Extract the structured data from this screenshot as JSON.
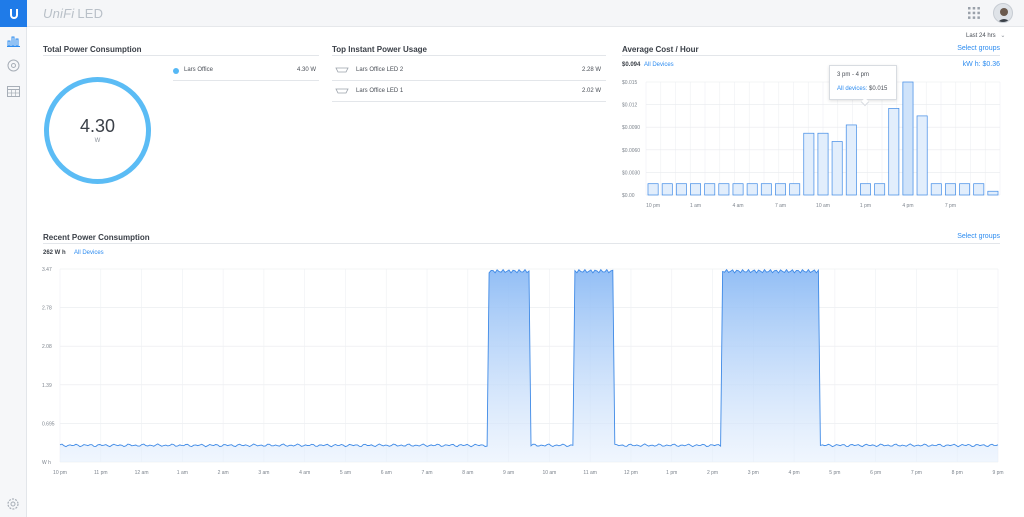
{
  "brand": {
    "name": "UniFi",
    "product": "LED"
  },
  "header": {
    "range_label": "Last 24 hrs"
  },
  "total_power": {
    "title": "Total Power Consumption",
    "value": "4.30",
    "unit": "W",
    "legend": [
      {
        "name": "Lars Office",
        "value": "4.30 W"
      }
    ]
  },
  "top_instant": {
    "title": "Top Instant Power Usage",
    "rows": [
      {
        "name": "Lars Office LED 2",
        "value": "2.28 W"
      },
      {
        "name": "Lars Office LED 1",
        "value": "2.02 W"
      }
    ]
  },
  "avg_cost": {
    "title": "Average Cost / Hour",
    "select_groups": "Select groups",
    "total": "$0.094",
    "filter": "All Devices",
    "rate": "kW h: $0.36",
    "tooltip": {
      "time": "3 pm - 4 pm",
      "label": "All devices:",
      "value": "$0.015"
    }
  },
  "recent_power": {
    "title": "Recent Power Consumption",
    "select_groups": "Select groups",
    "total": "262 W h",
    "filter": "All Devices"
  },
  "chart_data": [
    {
      "type": "bar",
      "y_ticks": [
        "$0.00",
        "$0.0030",
        "$0.0060",
        "$0.0090",
        "$0.012",
        "$0.015"
      ],
      "x_ticks": [
        "10 pm",
        "1 am",
        "4 am",
        "7 am",
        "10 am",
        "1 pm",
        "4 pm",
        "7 pm"
      ],
      "ylim": [
        0,
        0.015
      ],
      "values": [
        0.0015,
        0.0015,
        0.0015,
        0.0015,
        0.0015,
        0.0015,
        0.0015,
        0.0015,
        0.0015,
        0.0015,
        0.0015,
        0.0082,
        0.0082,
        0.0071,
        0.0093,
        0.0015,
        0.0015,
        0.0115,
        0.015,
        0.0105,
        0.0015,
        0.0015,
        0.0015,
        0.0015,
        0.0005
      ],
      "highlight_index": 18
    },
    {
      "type": "area",
      "y_ticks": [
        "W h",
        "0.695",
        "1.39",
        "2.08",
        "2.78",
        "3.47"
      ],
      "x_ticks": [
        "10 pm",
        "11 pm",
        "12 am",
        "1 am",
        "2 am",
        "3 am",
        "4 am",
        "5 am",
        "6 am",
        "7 am",
        "8 am",
        "9 am",
        "10 am",
        "11 am",
        "12 pm",
        "1 pm",
        "2 pm",
        "3 pm",
        "4 pm",
        "5 pm",
        "6 pm",
        "7 pm",
        "8 pm",
        "9 pm"
      ],
      "ylim": [
        0,
        3.47
      ],
      "baseline": 0.3,
      "peak": 3.45,
      "segments": [
        {
          "start": 10.5,
          "end": 11.5
        },
        {
          "start": 12.6,
          "end": 13.6
        },
        {
          "start": 16.2,
          "end": 18.6
        }
      ]
    }
  ]
}
